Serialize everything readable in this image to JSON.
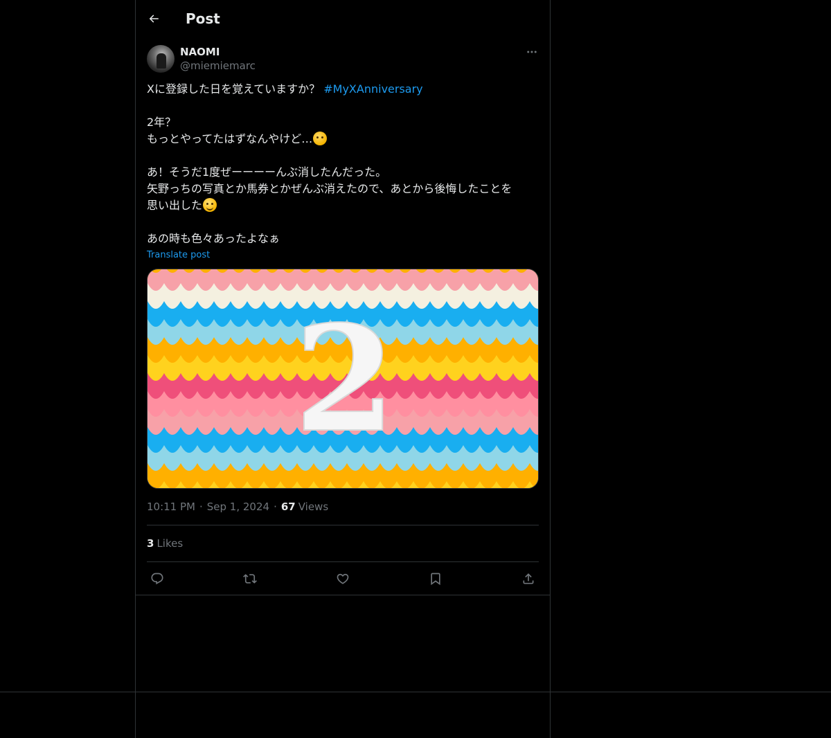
{
  "header": {
    "title": "Post"
  },
  "post": {
    "author_name": "NAOMI",
    "author_handle": "@miemiemarc",
    "text_lines": [
      {
        "text": "Xに登録した日を覚えていますか？ ",
        "hashtag": "#MyXAnniversary"
      },
      {
        "text": ""
      },
      {
        "text": "2年？"
      },
      {
        "text": "もっとやってたはずなんやけど…",
        "emoji": "thinking-face-emoji"
      },
      {
        "text": ""
      },
      {
        "text": "あ！そうだ1度ぜーーーーんぶ消したんだった。"
      },
      {
        "text": "矢野っちの写真とか馬券とかぜんぶ消えたので、あとから後悔したことを"
      },
      {
        "text": "思い出した",
        "emoji": "grinning-sweat-emoji"
      },
      {
        "text": ""
      },
      {
        "text": "あの時も色々あったよなぁ"
      }
    ],
    "translate_label": "Translate post",
    "media_number": "2",
    "time": "10:11 PM",
    "date": "Sep 1, 2024",
    "views_count": "67",
    "views_label": "Views",
    "likes_count": "3",
    "likes_label": "Likes",
    "separator": "·"
  },
  "colors": {
    "background": "#000000",
    "text": "#e7e9ea",
    "muted": "#71767b",
    "accent": "#1d9bf0",
    "border": "#2f3336"
  },
  "icons": {
    "back": "arrow-left-icon",
    "more": "more-horizontal-icon",
    "reply": "reply-icon",
    "repost": "repost-icon",
    "like": "heart-icon",
    "bookmark": "bookmark-icon",
    "share": "share-icon"
  }
}
